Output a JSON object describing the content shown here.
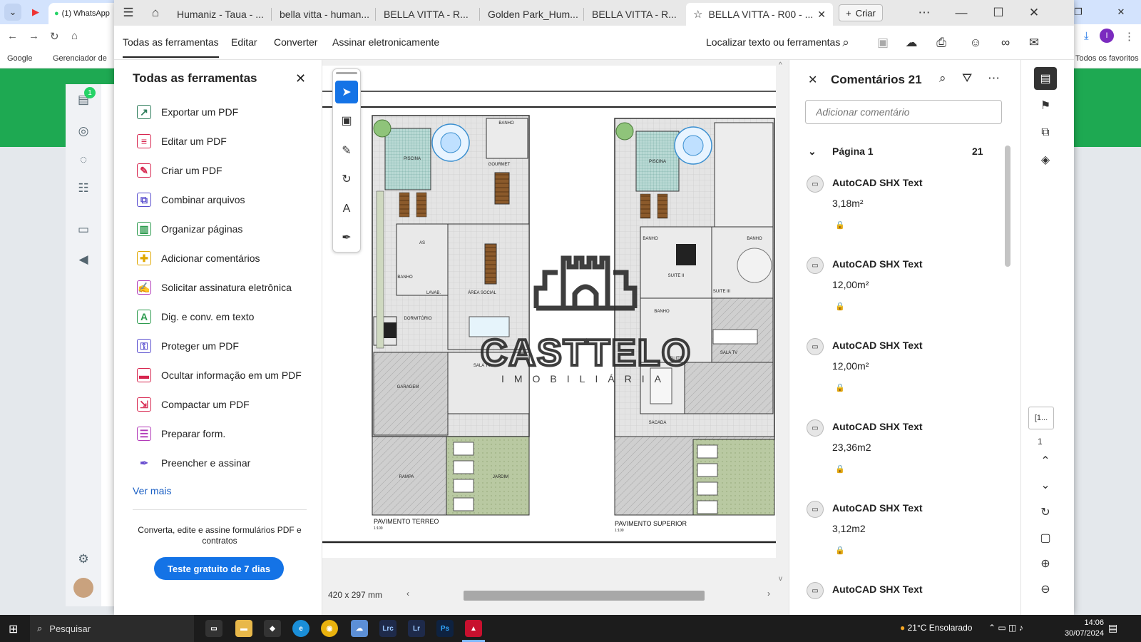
{
  "bg_browser": {
    "active_tab": "(1) WhatsApp",
    "bookmarks": [
      "Google",
      "Gerenciador de",
      "Todos os favoritos"
    ],
    "notification_badge": "1"
  },
  "acrobat": {
    "tabs": [
      "Humaniz - Taua - ...",
      "bella vitta - human...",
      "BELLA VITTA - R...",
      "Golden Park_Hum...",
      "BELLA VITTA - R...",
      "BELLA VITTA - R00 - ..."
    ],
    "new_tab_label": "Criar",
    "menu": {
      "items": [
        "Todas as ferramentas",
        "Editar",
        "Converter",
        "Assinar eletronicamente"
      ],
      "search_label": "Localizar texto ou ferramentas"
    },
    "tools_panel": {
      "title": "Todas as ferramentas",
      "items": [
        {
          "label": "Exportar um PDF",
          "icon": "export-pdf-icon",
          "color": "#2e7d5b"
        },
        {
          "label": "Editar um PDF",
          "icon": "edit-pdf-icon",
          "color": "#d7264f"
        },
        {
          "label": "Criar um PDF",
          "icon": "create-pdf-icon",
          "color": "#d7264f"
        },
        {
          "label": "Combinar arquivos",
          "icon": "combine-files-icon",
          "color": "#5a4fcf"
        },
        {
          "label": "Organizar páginas",
          "icon": "organize-pages-icon",
          "color": "#2e9b4f"
        },
        {
          "label": "Adicionar comentários",
          "icon": "add-comment-icon",
          "color": "#e0a800"
        },
        {
          "label": "Solicitar assinatura eletrônica",
          "icon": "request-signature-icon",
          "color": "#b23ab8"
        },
        {
          "label": "Dig. e conv. em texto",
          "icon": "ocr-icon",
          "color": "#2e9b4f"
        },
        {
          "label": "Proteger um PDF",
          "icon": "protect-pdf-icon",
          "color": "#5a4fcf"
        },
        {
          "label": "Ocultar informação em um PDF",
          "icon": "redact-icon",
          "color": "#d7264f"
        },
        {
          "label": "Compactar um PDF",
          "icon": "compress-pdf-icon",
          "color": "#d7264f"
        },
        {
          "label": "Preparar form.",
          "icon": "prepare-form-icon",
          "color": "#b23ab8"
        },
        {
          "label": "Preencher e assinar",
          "icon": "fill-sign-icon",
          "color": "#6a4fcf"
        }
      ],
      "see_more": "Ver mais",
      "promo_text": "Converta, edite e assine formulários PDF e contratos",
      "promo_button": "Teste gratuito de 7 dias"
    },
    "document": {
      "floor_labels": [
        "PAVIMENTO TERREO",
        "PAVIMENTO SUPERIOR"
      ],
      "scale_labels": [
        "1:100",
        "1:100"
      ],
      "room_labels_ground": [
        "PISCINA",
        "BANHO",
        "GOURMET",
        "AS",
        "BANHO",
        "LAVAB.",
        "ÁREA SOCIAL",
        "DORMITÓRIO",
        "SALA TV",
        "GARAGEM",
        "RAMPA",
        "JARDIM"
      ],
      "room_labels_upper": [
        "PISCINA",
        "BANHO",
        "SUITE II",
        "BANHO",
        "SUITE III",
        "BANHO",
        "SALA TV",
        "SUITE",
        "SACADA"
      ],
      "watermark_text": "CASTTELO",
      "watermark_sub": "IMOBILIÁRIA",
      "page_size": "420 x 297 mm"
    },
    "comments_panel": {
      "title": "Comentários 21",
      "input_placeholder": "Adicionar comentário",
      "page_group": "Página 1",
      "page_group_count": "21",
      "comments": [
        {
          "author": "AutoCAD SHX Text",
          "text": "3,18m²"
        },
        {
          "author": "AutoCAD SHX Text",
          "text": "12,00m²"
        },
        {
          "author": "AutoCAD SHX Text",
          "text": "12,00m²"
        },
        {
          "author": "AutoCAD SHX Text",
          "text": "23,36m2"
        },
        {
          "author": "AutoCAD SHX Text",
          "text": "3,12m2"
        },
        {
          "author": "AutoCAD SHX Text",
          "text": ""
        }
      ]
    },
    "rail": {
      "page_box": "[1...",
      "page_number": "1"
    }
  },
  "taskbar": {
    "search_placeholder": "Pesquisar",
    "weather": "21°C  Ensolarado",
    "time": "14:06",
    "date": "30/07/2024",
    "apps": [
      "Lrc",
      "Lr",
      "Ps"
    ]
  }
}
